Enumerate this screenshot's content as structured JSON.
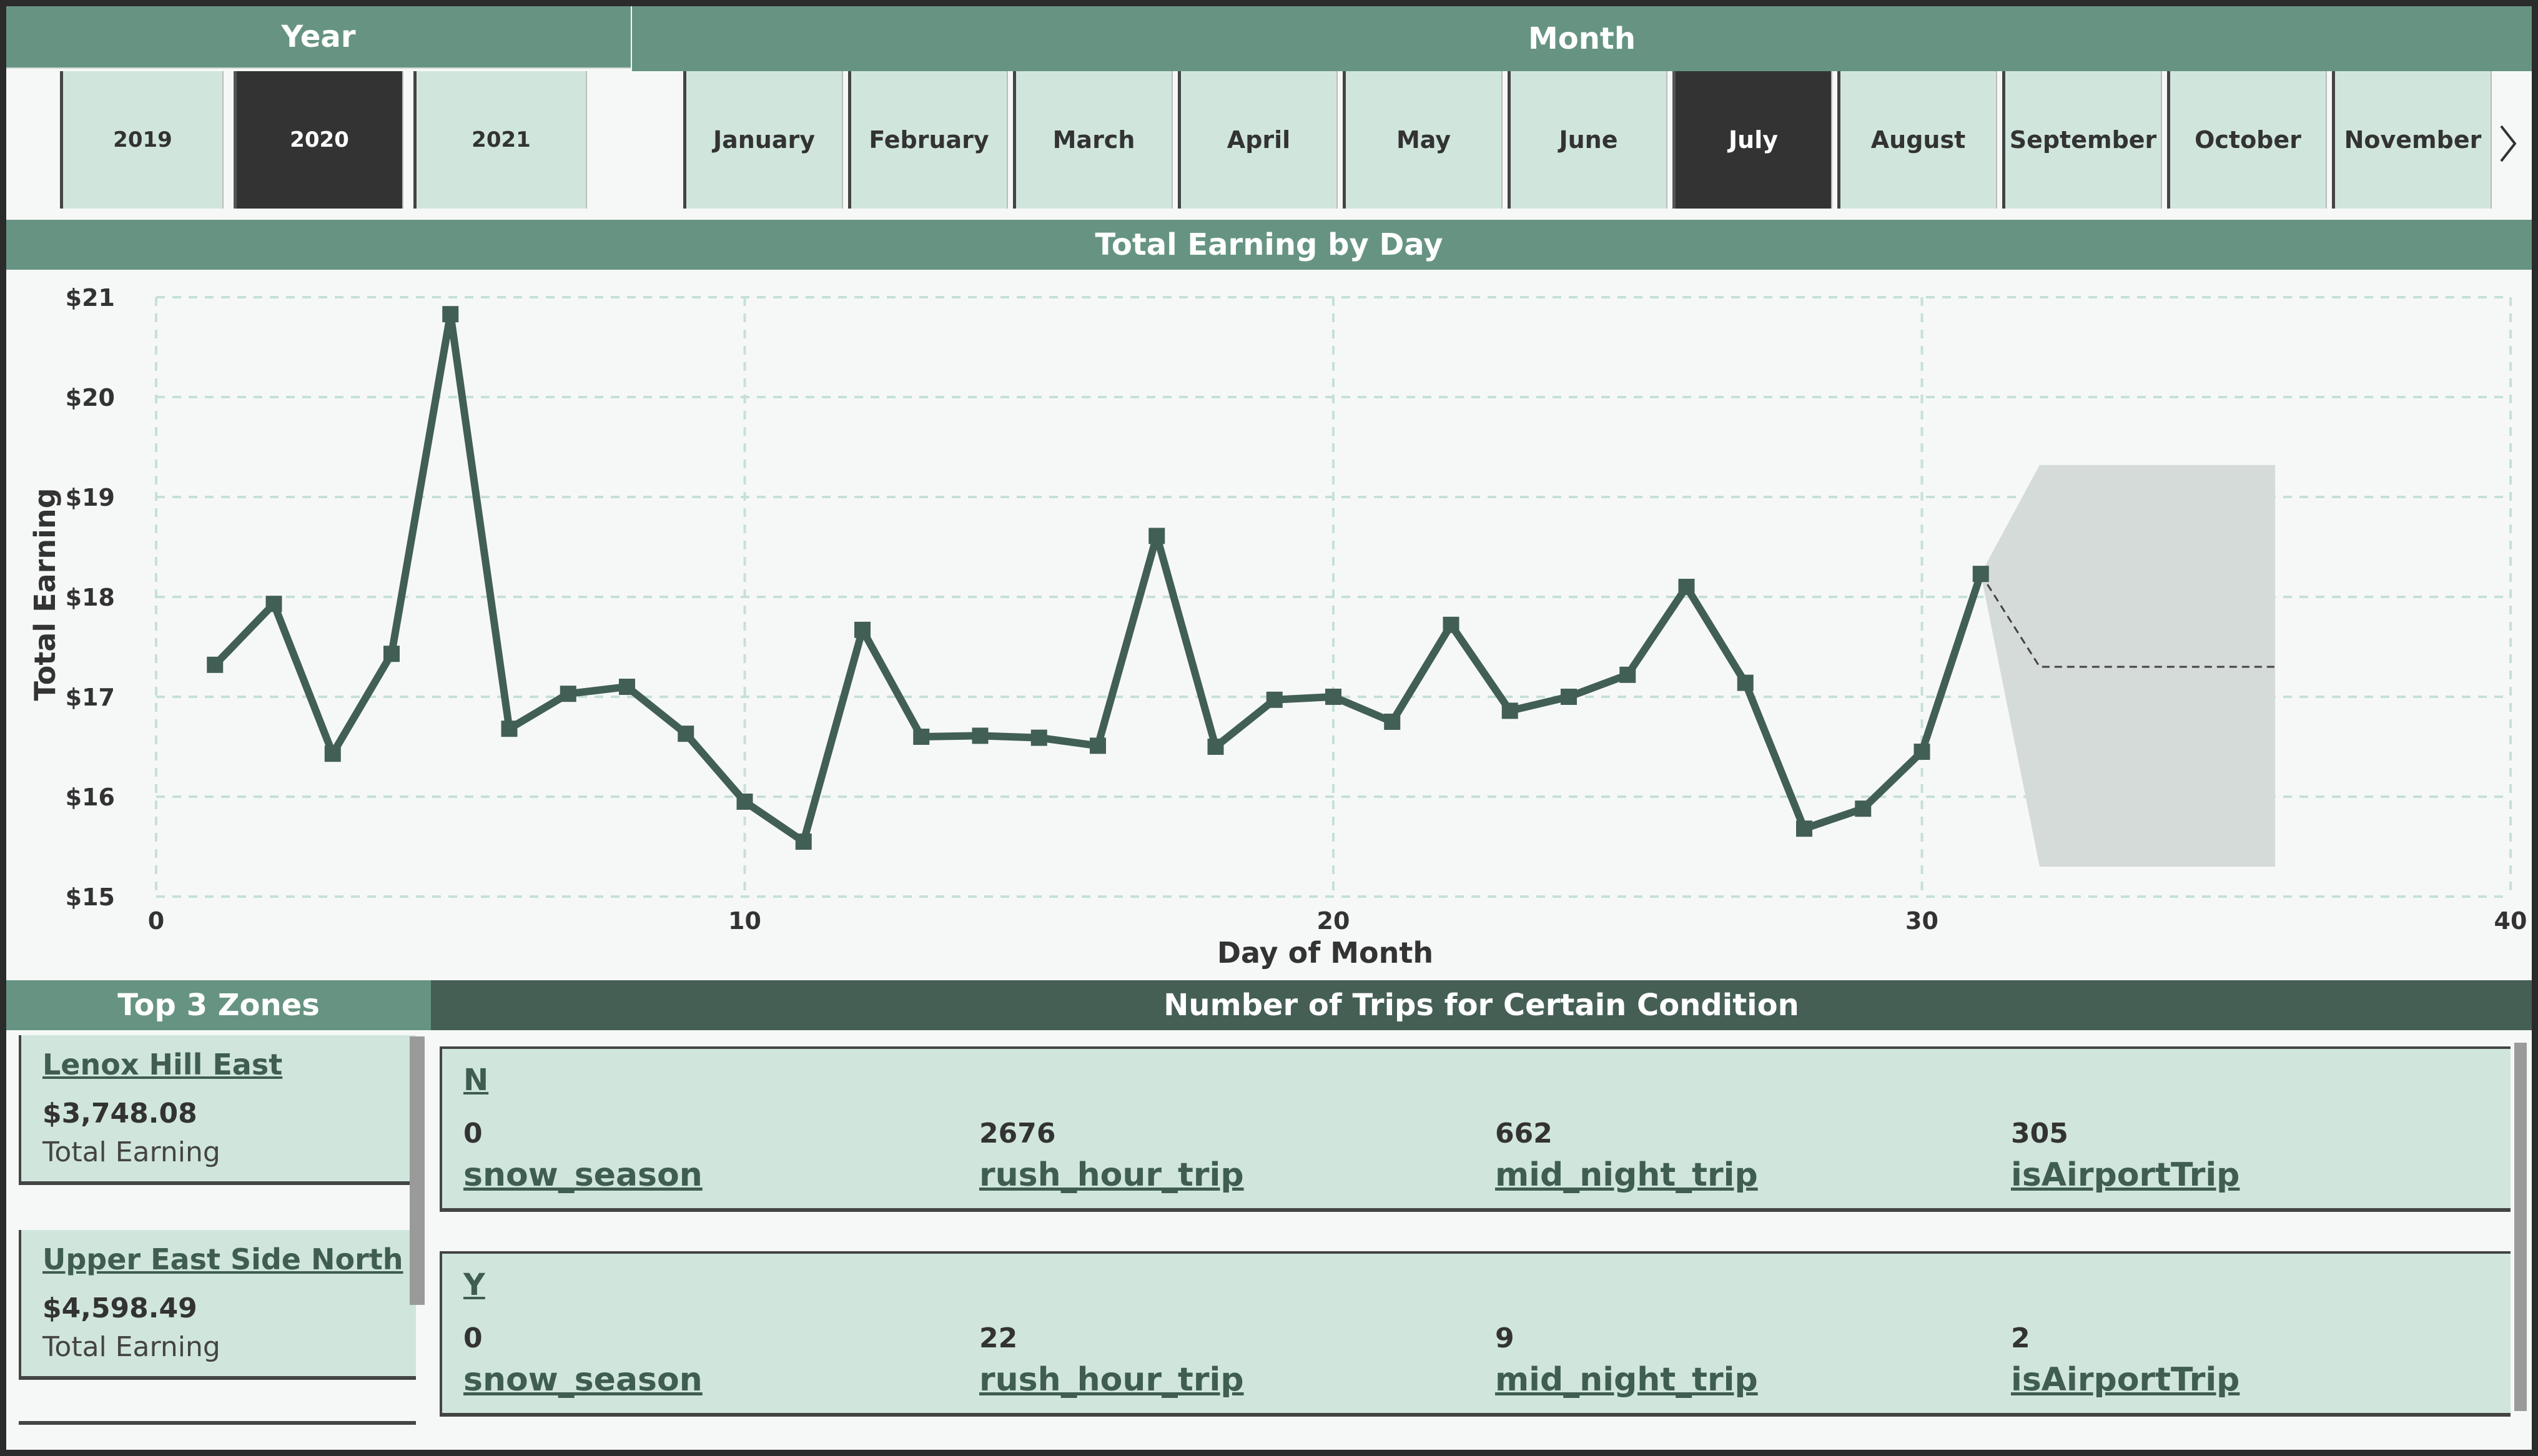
{
  "year_slicer": {
    "title": "Year",
    "options": [
      "2019",
      "2020",
      "2021"
    ],
    "selected": "2020"
  },
  "month_slicer": {
    "title": "Month",
    "options": [
      "January",
      "February",
      "March",
      "April",
      "May",
      "June",
      "July",
      "August",
      "September",
      "October",
      "November"
    ],
    "selected": "July",
    "next_icon": "chevron-right-icon"
  },
  "chart": {
    "header": "Total Earning by Day"
  },
  "chart_data": {
    "type": "line",
    "title": "Total Earning by Day",
    "xlabel": "Day of Month",
    "ylabel": "Total Earning",
    "xlim": [
      0,
      40
    ],
    "ylim": [
      15,
      21
    ],
    "x_ticks": [
      0,
      10,
      20,
      30,
      40
    ],
    "y_ticks": [
      "$15",
      "$16",
      "$17",
      "$18",
      "$19",
      "$20",
      "$21"
    ],
    "grid": true,
    "x": [
      1,
      2,
      3,
      4,
      5,
      6,
      7,
      8,
      9,
      10,
      11,
      12,
      13,
      14,
      15,
      16,
      17,
      18,
      19,
      20,
      21,
      22,
      23,
      24,
      25,
      26,
      27,
      28,
      29,
      30,
      31
    ],
    "values": [
      17.32,
      17.93,
      16.43,
      17.43,
      20.83,
      16.68,
      17.03,
      17.1,
      16.63,
      15.95,
      15.55,
      17.67,
      16.6,
      16.61,
      16.59,
      16.51,
      18.61,
      16.5,
      16.97,
      17.0,
      16.75,
      17.72,
      16.86,
      17.0,
      17.22,
      18.1,
      17.14,
      15.68,
      15.88,
      16.45,
      18.23
    ],
    "forecast": {
      "x": [
        31,
        32,
        36
      ],
      "values": [
        18.23,
        17.3,
        17.3
      ],
      "upper": [
        18.23,
        19.32,
        19.32
      ],
      "lower": [
        18.23,
        15.3,
        15.3
      ]
    },
    "colors": {
      "line": "#425f55",
      "band": "#d4dbd8",
      "grid": "#c6e0d6"
    }
  },
  "zones": {
    "title": "Top 3 Zones",
    "items": [
      {
        "name": "Lenox Hill East",
        "value": "$3,748.08",
        "label": "Total Earning"
      },
      {
        "name": "Upper East Side North",
        "value": "$4,598.49",
        "label": "Total Earning"
      }
    ]
  },
  "conditions": {
    "title": "Number of Trips for Certain Condition",
    "rows": [
      {
        "key": "N",
        "metrics": [
          {
            "value": "0",
            "label": "snow_season"
          },
          {
            "value": "2676",
            "label": "rush_hour_trip"
          },
          {
            "value": "662",
            "label": "mid_night_trip"
          },
          {
            "value": "305",
            "label": "isAirportTrip"
          }
        ]
      },
      {
        "key": "Y",
        "metrics": [
          {
            "value": "0",
            "label": "snow_season"
          },
          {
            "value": "22",
            "label": "rush_hour_trip"
          },
          {
            "value": "9",
            "label": "mid_night_trip"
          },
          {
            "value": "2",
            "label": "isAirportTrip"
          }
        ]
      }
    ]
  },
  "colors": {
    "header": "#679482",
    "header_dark": "#455f55",
    "card": "#d0e6dc",
    "selected": "#333333",
    "link_text": "#3f5d51"
  }
}
